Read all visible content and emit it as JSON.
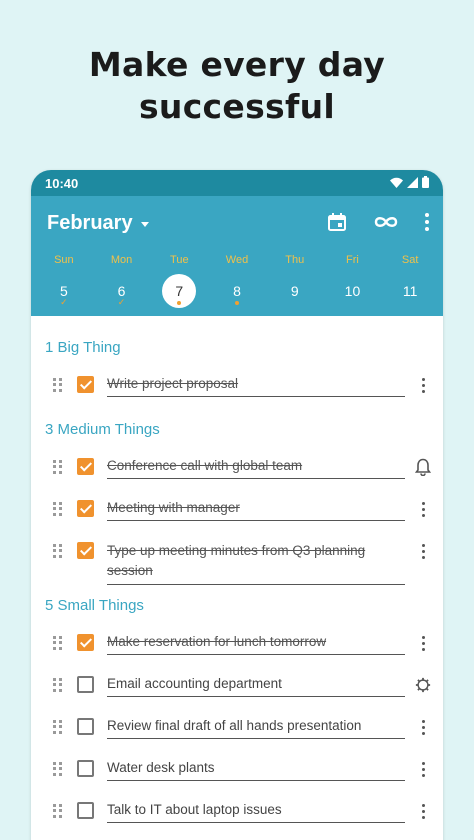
{
  "headline": {
    "line1": "Make every day",
    "line2": "successful"
  },
  "status": {
    "time": "10:40"
  },
  "appbar": {
    "month": "February"
  },
  "days": [
    {
      "dow": "Sun",
      "num": "5",
      "mark": "check"
    },
    {
      "dow": "Mon",
      "num": "6",
      "mark": "check"
    },
    {
      "dow": "Tue",
      "num": "7",
      "mark": "dot",
      "selected": true
    },
    {
      "dow": "Wed",
      "num": "8",
      "mark": "dot"
    },
    {
      "dow": "Thu",
      "num": "9",
      "mark": ""
    },
    {
      "dow": "Fri",
      "num": "10",
      "mark": ""
    },
    {
      "dow": "Sat",
      "num": "11",
      "mark": ""
    }
  ],
  "sections": [
    {
      "title": "1 Big Thing",
      "tasks": [
        {
          "text": "Write project proposal",
          "done": true,
          "tail": "more"
        }
      ]
    },
    {
      "title": "3 Medium Things",
      "tasks": [
        {
          "text": "Conference call with global team",
          "done": true,
          "tail": "bell"
        },
        {
          "text": "Meeting with manager",
          "done": true,
          "tail": "more"
        },
        {
          "text": "Type up meeting minutes from Q3 planning session",
          "done": true,
          "tail": "more",
          "tall": true
        }
      ]
    },
    {
      "title": "5 Small Things",
      "tasks": [
        {
          "text": "Make reservation for lunch tomorrow",
          "done": true,
          "tail": "more"
        },
        {
          "text": "Email accounting department",
          "done": false,
          "tail": "gear"
        },
        {
          "text": "Review final draft of all hands presentation",
          "done": false,
          "tail": "more"
        },
        {
          "text": "Water desk plants",
          "done": false,
          "tail": "more"
        },
        {
          "text": "Talk to IT about laptop issues",
          "done": false,
          "tail": "more"
        }
      ]
    }
  ],
  "colors": {
    "accent": "#3aa6c2",
    "status_bar": "#1e8aa0",
    "checkbox": "#f0922e",
    "weekday": "#f0c14a"
  }
}
